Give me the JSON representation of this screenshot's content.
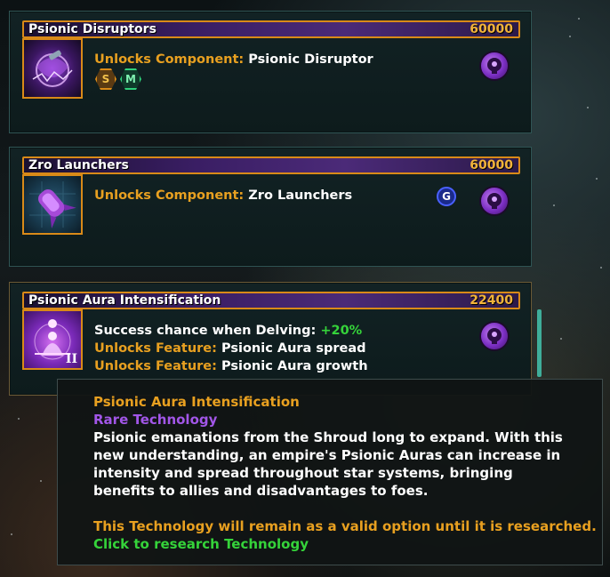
{
  "cards": [
    {
      "title": "Psionic Disruptors",
      "cost": "60000",
      "thumb_icon": "psionic-disruptor-icon",
      "lines": [
        {
          "label": "Unlocks Component:",
          "value": "Psionic Disruptor"
        }
      ],
      "badges": [
        "S",
        "M"
      ]
    },
    {
      "title": "Zro Launchers",
      "cost": "60000",
      "thumb_icon": "zro-launcher-icon",
      "lines": [
        {
          "label": "Unlocks Component:",
          "value": "Zro Launchers"
        }
      ],
      "badge_g": "G"
    },
    {
      "title": "Psionic Aura Intensification",
      "cost": "22400",
      "thumb_icon": "psionic-aura-icon",
      "tier": "II",
      "lines": [
        {
          "prefix": "Success chance when Delving:",
          "bonus": "+20%"
        },
        {
          "label": "Unlocks Feature:",
          "value": "Psionic Aura spread"
        },
        {
          "label": "Unlocks Feature:",
          "value": "Psionic Aura growth"
        }
      ]
    }
  ],
  "tooltip": {
    "title": "Psionic Aura Intensification",
    "rarity": "Rare Technology",
    "description": "Psionic emanations from the Shroud long to expand. With this new understanding, an empire's Psionic Auras can increase in intensity and spread throughout star systems, bringing benefits to allies and disadvantages to foes.",
    "remain_note": "This Technology will remain as a valid option until it is researched.",
    "click_note": "Click to research Technology"
  },
  "colors": {
    "accent_orange": "#e8a020",
    "rare_purple": "#a256e8",
    "positive_green": "#35d33a"
  }
}
